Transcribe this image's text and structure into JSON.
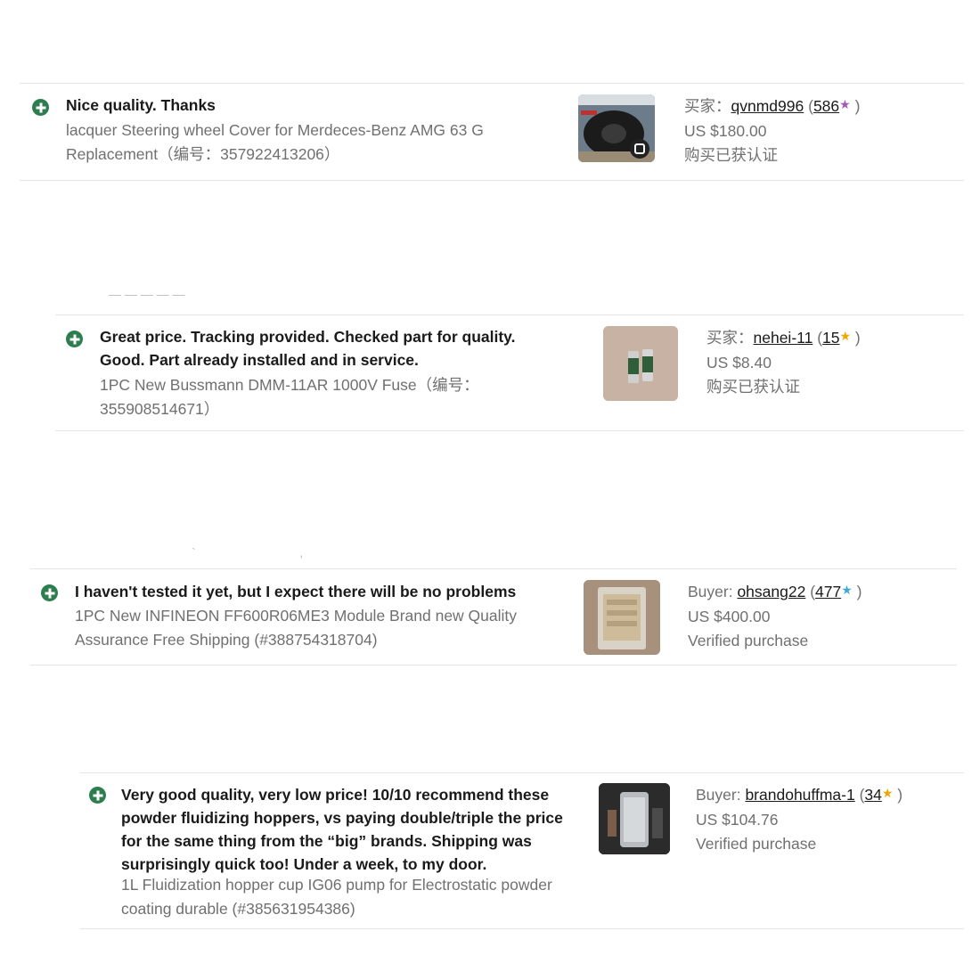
{
  "reviews": [
    {
      "comment": "Nice quality. Thanks",
      "product": "lacquer Steering wheel Cover for Merdeces-Benz AMG 63 G Replacement（编号：357922413206）",
      "buyer_label": "买家：",
      "buyer": "qvnmd996",
      "score": "586",
      "star_color": "#a35ab8",
      "price": "US $180.00",
      "verified": "购买已获认证",
      "thumb_icon": "steering-wheel-cover-photo"
    },
    {
      "comment": "Great price. Tracking provided. Checked part for quality. Good. Part already installed and in service.",
      "product": "1PC New Bussmann DMM-11AR 1000V Fuse（编号：355908514671）",
      "buyer_label": "买家：",
      "buyer": "nehei-11",
      "score": "15",
      "star_color": "#f0a500",
      "price": "US $8.40",
      "verified": "购买已获认证",
      "thumb_icon": "fuse-photo"
    },
    {
      "comment": "I haven't tested it yet, but I expect there will be no problems",
      "product": "1PC New INFINEON FF600R06ME3 Module Brand new Quality Assurance Free Shipping (#388754318704)",
      "buyer_label": "Buyer: ",
      "buyer": "ohsang22",
      "score": "477",
      "star_color": "#3fa9d6",
      "price": "US $400.00",
      "verified": "Verified purchase",
      "thumb_icon": "igbt-module-photo"
    },
    {
      "comment": "Very good quality, very low price! 10/10 recommend these powder fluidizing hoppers, vs paying double/triple the price for the same thing from the “big” brands. Shipping was surprisingly quick too! Under a week, to my door.",
      "product": "1L Fluidization hopper cup IG06 pump for Electrostatic powder coating durable (#385631954386)",
      "buyer_label": "Buyer: ",
      "buyer": "brandohuffma-1",
      "score": "34",
      "star_color": "#f0a500",
      "price": "US $104.76",
      "verified": "Verified purchase",
      "thumb_icon": "powder-hopper-photo"
    }
  ],
  "colors": {
    "positive_icon": "#2e7d4f",
    "divider": "#e4e4e4",
    "secondary_text": "#707070"
  }
}
